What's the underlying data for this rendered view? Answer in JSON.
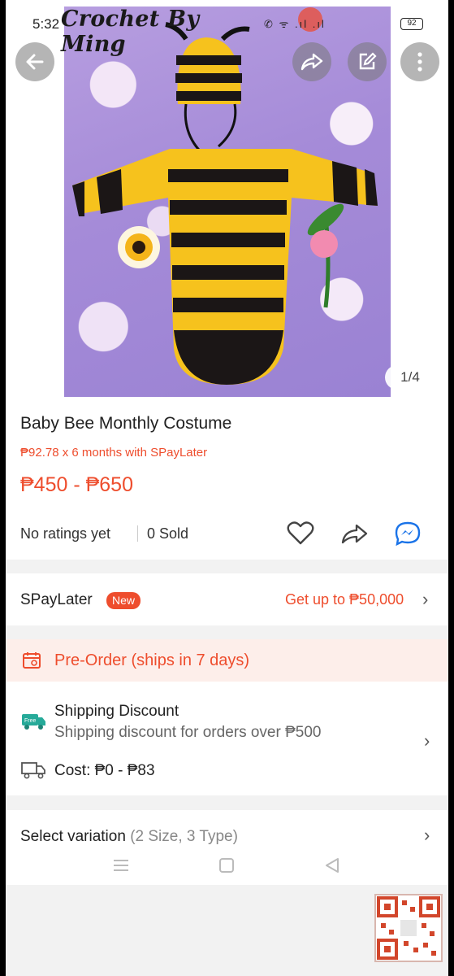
{
  "status_bar": {
    "time": "5:32",
    "battery": "92"
  },
  "photo": {
    "watermark": "Crochet By Ming",
    "counter": "1/4"
  },
  "product": {
    "title": "Baby Bee Monthly Costume",
    "installment": "₱92.78 x 6 months with SPayLater",
    "price_range": "₱450 - ₱650",
    "ratings": "No ratings yet",
    "sold": "0 Sold"
  },
  "spaylater": {
    "label": "SPayLater",
    "badge": "New",
    "offer": "Get up to ₱50,000"
  },
  "preorder": {
    "label": "Pre-Order (ships in 7 days)"
  },
  "shipping": {
    "title": "Shipping Discount",
    "subtitle": "Shipping discount for orders over ₱500",
    "cost": "Cost: ₱0 - ₱83",
    "free_tag": "Free"
  },
  "variation": {
    "label": "Select variation",
    "detail": "(2 Size, 3 Type)"
  },
  "colors": {
    "accent": "#ee4d2d",
    "preorder_bg": "#fdeeea",
    "messenger": "#1a73e8"
  },
  "icons": {
    "back": "arrow-left-icon",
    "share_top": "share-icon",
    "edit": "edit-icon",
    "more": "more-vertical-icon",
    "like": "heart-icon",
    "share": "share-icon",
    "chat": "messenger-icon",
    "calendar": "calendar-icon",
    "truck": "truck-icon"
  }
}
